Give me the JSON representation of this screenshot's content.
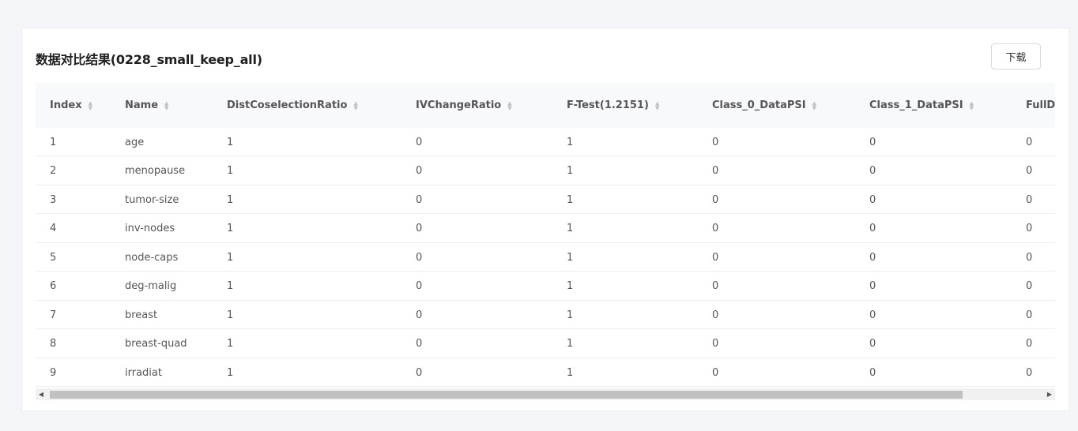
{
  "title": "数据对比结果(0228_small_keep_all)",
  "download_label": "下载",
  "table": {
    "columns": [
      "Index",
      "Name",
      "DistCoselectionRatio",
      "IVChangeRatio",
      "F-Test(1.2151)",
      "Class_0_DataPSI",
      "Class_1_DataPSI",
      "FullD"
    ],
    "rows": [
      [
        "1",
        "age",
        "1",
        "0",
        "1",
        "0",
        "0",
        "0"
      ],
      [
        "2",
        "menopause",
        "1",
        "0",
        "1",
        "0",
        "0",
        "0"
      ],
      [
        "3",
        "tumor-size",
        "1",
        "0",
        "1",
        "0",
        "0",
        "0"
      ],
      [
        "4",
        "inv-nodes",
        "1",
        "0",
        "1",
        "0",
        "0",
        "0"
      ],
      [
        "5",
        "node-caps",
        "1",
        "0",
        "1",
        "0",
        "0",
        "0"
      ],
      [
        "6",
        "deg-malig",
        "1",
        "0",
        "1",
        "0",
        "0",
        "0"
      ],
      [
        "7",
        "breast",
        "1",
        "0",
        "1",
        "0",
        "0",
        "0"
      ],
      [
        "8",
        "breast-quad",
        "1",
        "0",
        "1",
        "0",
        "0",
        "0"
      ],
      [
        "9",
        "irradiat",
        "1",
        "0",
        "1",
        "0",
        "0",
        "0"
      ]
    ]
  },
  "scrollbar": {
    "left_arrow": "◀",
    "right_arrow": "▶"
  }
}
